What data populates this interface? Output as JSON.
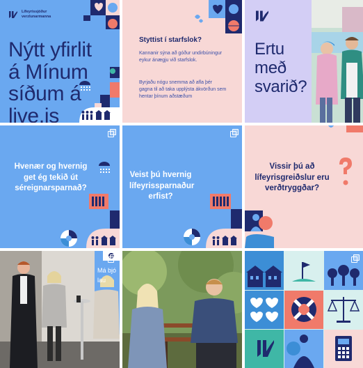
{
  "brand": {
    "line1": "Lífeyrissjóður",
    "line2": "verzlunarmanna",
    "logo_glyph": "LV"
  },
  "posts": [
    {
      "kind": "text",
      "title": "Nýtt yfirlit á Mínum síðum á live.is",
      "bg": "#6aa8f0"
    },
    {
      "kind": "text",
      "title": "Styttist í starfslok?",
      "body1": "Kannanir sýna að góður undirbúningur eykur ánægju við starfslok.",
      "body2": "Byrjaðu nógu snemma að afla þér gagna til að taka upplýsta ákvörðun sem hentar þínum aðstæðum",
      "bg": "#f8d8d6"
    },
    {
      "kind": "photo",
      "title": "Ertu með svarið?",
      "bg": "#d3cef5"
    },
    {
      "kind": "text",
      "title": "Hvenær og hvernig get ég tekið út séreignarsparnað?",
      "bg": "#6aa8f0"
    },
    {
      "kind": "text",
      "title": "Veist þú hvernig lífeyrissparnaður erfist?",
      "bg": "#6aa8f0"
    },
    {
      "kind": "text",
      "title": "Vissir þú að lífeyrisgreiðslur eru verðtryggðar?",
      "bg": "#f8d8d6"
    },
    {
      "kind": "photo",
      "title": "Group photo at event",
      "sign_text": "Má bjó lau"
    },
    {
      "kind": "photo",
      "title": "Two people on a bench"
    },
    {
      "kind": "icons",
      "title": "Icon mosaic"
    }
  ],
  "colors": {
    "navy": "#1f2a6e",
    "blue": "#6aa8f0",
    "pink": "#f8d8d6",
    "coral": "#f07a6a",
    "teal": "#3fb7a6",
    "lavender": "#d3cef5"
  }
}
